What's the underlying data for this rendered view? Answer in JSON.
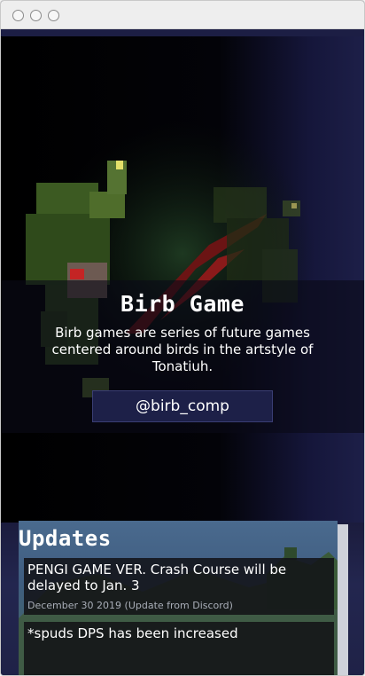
{
  "hero": {
    "title": "Birb Game",
    "description": "Birb games are series of future games centered around birds in the artstyle of Tonatiuh.",
    "handle_button": "@birb_comp"
  },
  "updates": {
    "heading": "Updates",
    "items": [
      {
        "headline": "PENGI GAME VER. Crash Course will be delayed to Jan. 3",
        "meta": "December 30 2019 (Update from Discord)"
      },
      {
        "headline": "*spuds DPS has been increased",
        "meta": ""
      }
    ]
  },
  "icons": {
    "window_controls": [
      "window-circle-icon",
      "window-circle-icon",
      "window-circle-icon"
    ]
  },
  "colors": {
    "page_background": "#1c1e44",
    "button_background": "#1d2048",
    "updates_panel": "#4a6a8e"
  }
}
